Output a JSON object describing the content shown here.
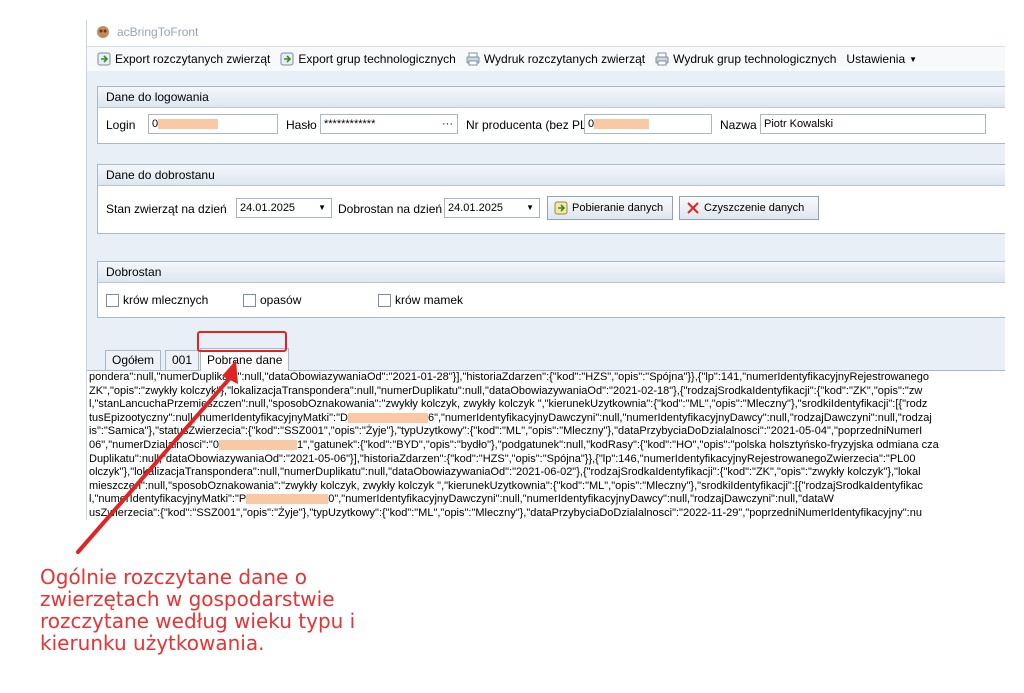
{
  "window": {
    "title": "acBringToFront"
  },
  "menu": {
    "items": [
      {
        "label": "Export rozczytanych zwierząt"
      },
      {
        "label": "Export grup technologicznych"
      },
      {
        "label": "Wydruk rozczytanych zwierząt"
      },
      {
        "label": "Wydruk grup technologicznych"
      },
      {
        "label": "Ustawienia"
      }
    ]
  },
  "login_group": {
    "title": "Dane do logowania",
    "login_label": "Login",
    "login_value": "0",
    "password_label": "Hasło",
    "password_value": "************",
    "producer_label": "Nr producenta (bez PL)",
    "producer_value": "0",
    "name_label": "Nazwa",
    "name_value": "Piotr Kowalski"
  },
  "welfare_group": {
    "title": "Dane do dobrostanu",
    "stock_label": "Stan zwierząt na dzień",
    "stock_date": "24.01.2025",
    "welfare_label": "Dobrostan na dzień",
    "welfare_date": "24.01.2025",
    "fetch_button": "Pobieranie danych",
    "clear_button": "Czyszczenie danych"
  },
  "dobrostan_group": {
    "title": "Dobrostan",
    "checkboxes": [
      {
        "label": "krów mlecznych"
      },
      {
        "label": "opasów"
      },
      {
        "label": "krów mamek"
      }
    ]
  },
  "tabs": [
    {
      "label": "Ogółem"
    },
    {
      "label": "001"
    },
    {
      "label": "Pobrane dane"
    }
  ],
  "raw_lines": [
    "pondera\":null,\"numerDuplikatu\":null,\"dataObowiazywaniaOd\":\"2021-01-28\"}],\"historiaZdarzen\":{\"kod\":\"HZS\",\"opis\":\"Spójna\"}},{\"lp\":141,\"numerIdentyfikacyjnyRejestrowanego",
    "ZK\",\"opis\":\"zwykły kolczyk\"},\"lokalizacjaTranspondera\":null,\"numerDuplikatu\":null,\"dataObowiazywaniaOd\":\"2021-02-18\"},{\"rodzajSrodkaIdentyfikacji\":{\"kod\":\"ZK\",\"opis\":\"zw",
    "l,\"stanLancuchaPrzemieszczen\":null,\"sposobOznakowania\":\"zwykły kolczyk, zwykły kolczyk \",\"kierunekUzytkownia\":{\"kod\":\"ML\",\"opis\":\"Mleczny\"},\"srodkiIdentyfikacji\":[{\"rodz",
    "tusEpizootyczny\":null,\"numerIdentyfikacyjnyMatki\":\"D",
    "6\",\"numerIdentyfikacyjnyDawczyni\":null,\"numerIdentyfikacyjnyDawcy\":null,\"rodzajDawczyni\":null,\"rodzaj",
    "is\":\"Samica\"},\"statusZwierzecia\":{\"kod\":\"SSZ001\",\"opis\":\"Żyje\"},\"typUzytkowy\":{\"kod\":\"ML\",\"opis\":\"Mleczny\"},\"dataPrzybyciaDoDzialalnosci\":\"2021-05-04\",\"poprzedniNumerI",
    "06\",\"numerDzialalnosci\":\"0",
    "1\",\"gatunek\":{\"kod\":\"BYD\",\"opis\":\"bydło\"},\"podgatunek\":null,\"kodRasy\":{\"kod\":\"HO\",\"opis\":\"polska holsztyńsko-fryzyjska odmiana cza",
    "Duplikatu\":null,\"dataObowiazywaniaOd\":\"2021-05-06\"}],\"historiaZdarzen\":{\"kod\":\"HZS\",\"opis\":\"Spójna\"}},{\"lp\":146,\"numerIdentyfikacyjnyRejestrowanegoZwierzecia\":\"PL00",
    "olczyk\"},\"lokalizacjaTranspondera\":null,\"numerDuplikatu\":null,\"dataObowiazywaniaOd\":\"2021-06-02\"},{\"rodzajSrodkaIdentyfikacji\":{\"kod\":\"ZK\",\"opis\":\"zwykły kolczyk\"},\"lokal",
    "mieszczen\":null,\"sposobOznakowania\":\"zwykły kolczyk, zwykły kolczyk \",\"kierunekUzytkownia\":{\"kod\":\"ML\",\"opis\":\"Mleczny\"},\"srodkiIdentyfikacji\":[{\"rodzajSrodkaIdentyfikac",
    "l,\"numerIdentyfikacyjnyMatki\":\"P",
    "0\",\"numerIdentyfikacyjnyDawczyni\":null,\"numerIdentyfikacyjnyDawcy\":null,\"rodzajDawczyni\":null,\"dataW",
    "usZwierzecia\":{\"kod\":\"SSZ001\",\"opis\":\"Żyje\"},\"typUzytkowy\":{\"kod\":\"ML\",\"opis\":\"Mleczny\"},\"dataPrzybyciaDoDzialalnosci\":\"2022-11-29\",\"poprzedniNumerIdentyfikacyjny\":nu"
  ],
  "annotation": {
    "lines": [
      "Ogólnie rozczytane dane o",
      "zwierzętach w gospodarstwie",
      "rozczytane według wieku typu i",
      "kierunku użytkowania."
    ]
  },
  "colors": {
    "annotation_red": "#e63333",
    "redaction": "#f9c9a6",
    "accent_bg": "#e9eff7"
  }
}
